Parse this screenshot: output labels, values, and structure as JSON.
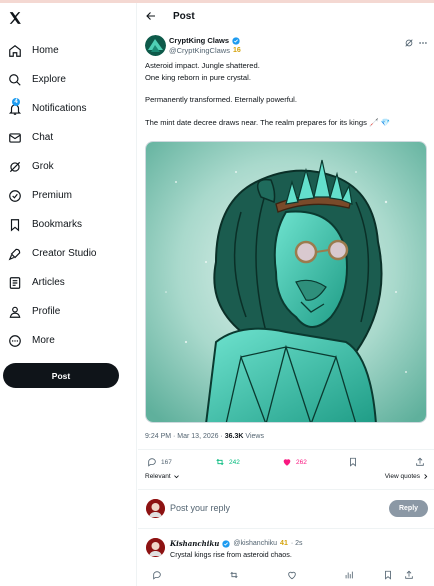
{
  "sidebar": {
    "logo_icon": "x-logo-icon",
    "items": [
      {
        "label": "Home",
        "icon": "home-icon"
      },
      {
        "label": "Explore",
        "icon": "search-icon"
      },
      {
        "label": "Notifications",
        "icon": "bell-icon",
        "badge": "4"
      },
      {
        "label": "Chat",
        "icon": "mail-icon"
      },
      {
        "label": "Grok",
        "icon": "grok-icon"
      },
      {
        "label": "Premium",
        "icon": "verified-icon"
      },
      {
        "label": "Bookmarks",
        "icon": "bookmark-icon"
      },
      {
        "label": "Creator Studio",
        "icon": "rocket-icon"
      },
      {
        "label": "Articles",
        "icon": "article-icon"
      },
      {
        "label": "Profile",
        "icon": "person-icon"
      },
      {
        "label": "More",
        "icon": "more-circle-icon"
      }
    ],
    "post_label": "Post"
  },
  "header": {
    "title": "Post"
  },
  "tweet": {
    "author_name": "CryptKing Claws",
    "author_handle": "@CryptKingClaws",
    "author_tag": "16",
    "lines": [
      "Asteroid impact. Jungle shattered.",
      "One king reborn in pure crystal.",
      "Permanently transformed. Eternally powerful.",
      "The mint date decree draws near. The realm prepares for its kings 🦯 💎"
    ],
    "timestamp": "9:24 PM · Mar 13, 2026 · ",
    "views_count": "36.3K",
    "views_label": " Views",
    "replies": "167",
    "reposts": "242",
    "likes": "262",
    "sort_label": "Relevant",
    "view_quotes": "View quotes"
  },
  "reply": {
    "placeholder": "Post your reply",
    "button": "Reply"
  },
  "comment": {
    "name": "Kishanchiku",
    "handle": "@kishanchiku",
    "tag": "41",
    "time": "· 2s",
    "text": "Crystal kings rise from asteroid chaos."
  },
  "colors": {
    "accent": "#1d9bf0",
    "repost": "#00ba7c",
    "like": "#f91880",
    "crystal": "#3fc9b0"
  }
}
